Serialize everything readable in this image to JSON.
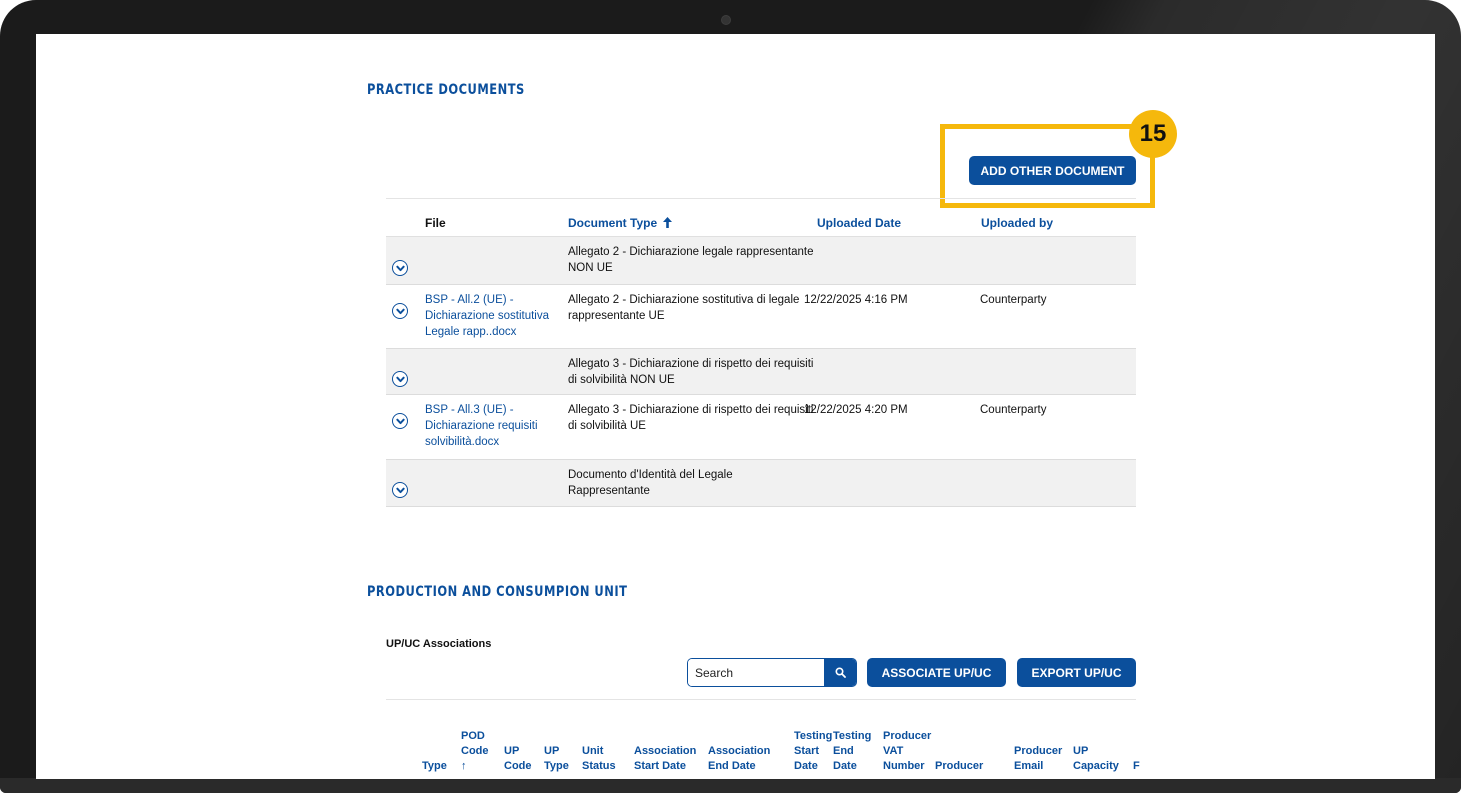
{
  "practice_documents": {
    "title": "PRACTICE DOCUMENTS",
    "add_button_label": "ADD OTHER DOCUMENT",
    "step_badge": "15",
    "columns": {
      "file": "File",
      "document_type": "Document Type",
      "uploaded_date": "Uploaded Date",
      "uploaded_by": "Uploaded by"
    },
    "rows": [
      {
        "file_lines": [
          "",
          "",
          ""
        ],
        "type_lines": [
          "Allegato 2 - Dichiarazione legale rappresentante",
          "NON UE"
        ],
        "date": "",
        "by": ""
      },
      {
        "file_lines": [
          "BSP - All.2 (UE) -",
          "Dichiarazione sostitutiva",
          "Legale rapp..docx"
        ],
        "type_lines": [
          "Allegato 2 - Dichiarazione sostitutiva di legale",
          "rappresentante UE"
        ],
        "date": "12/22/2025 4:16 PM",
        "by": "Counterparty"
      },
      {
        "file_lines": [
          "",
          "",
          ""
        ],
        "type_lines": [
          "Allegato 3 - Dichiarazione di rispetto dei requisiti",
          "di solvibilità NON UE"
        ],
        "date": "",
        "by": ""
      },
      {
        "file_lines": [
          "BSP - All.3 (UE) -",
          "Dichiarazione requisiti",
          "solvibilità.docx"
        ],
        "type_lines": [
          "Allegato 3 - Dichiarazione di rispetto dei requisiti",
          "di solvibilità UE"
        ],
        "date": "12/22/2025 4:20 PM",
        "by": "Counterparty"
      },
      {
        "file_lines": [
          "",
          "",
          ""
        ],
        "type_lines": [
          "Documento d'Identità del Legale",
          "Rappresentante"
        ],
        "date": "",
        "by": ""
      }
    ]
  },
  "production": {
    "title": "PRODUCTION AND CONSUMPION UNIT",
    "subtitle": "UP/UC Associations",
    "search_placeholder": "Search",
    "associate_label": "ASSOCIATE UP/UC",
    "export_label": "EXPORT UP/UC",
    "columns": [
      {
        "lines": [
          "Type"
        ],
        "color": "blue"
      },
      {
        "lines": [
          "POD",
          "Code",
          "↑"
        ],
        "color": "blue"
      },
      {
        "lines": [
          "UP",
          "Code"
        ],
        "color": "blue"
      },
      {
        "lines": [
          "UP",
          "Type"
        ],
        "color": "blue"
      },
      {
        "lines": [
          "Unit",
          "Status"
        ],
        "color": "blue"
      },
      {
        "lines": [
          "Association",
          "Start Date"
        ],
        "color": "blue"
      },
      {
        "lines": [
          "Association",
          "End Date"
        ],
        "color": "blue"
      },
      {
        "lines": [
          "Testing",
          "Start",
          "Date"
        ],
        "color": "blue"
      },
      {
        "lines": [
          "Testing",
          "End",
          "Date"
        ],
        "color": "blue"
      },
      {
        "lines": [
          "Producer",
          "VAT",
          "Number"
        ],
        "color": "blue"
      },
      {
        "lines": [
          "Producer"
        ],
        "color": "blue"
      },
      {
        "lines": [
          "Producer",
          "Email"
        ],
        "color": "blue"
      },
      {
        "lines": [
          "UP",
          "Capacity"
        ],
        "color": "blue"
      },
      {
        "lines": [
          "F"
        ],
        "color": "blue"
      }
    ]
  },
  "colors": {
    "primary": "#0b4f9c",
    "highlight": "#f5b80c",
    "row_shade": "#f1f1f1"
  },
  "icons": {
    "sort": "arrow-up-icon",
    "expand": "chevron-down-icon",
    "search": "search-icon"
  }
}
